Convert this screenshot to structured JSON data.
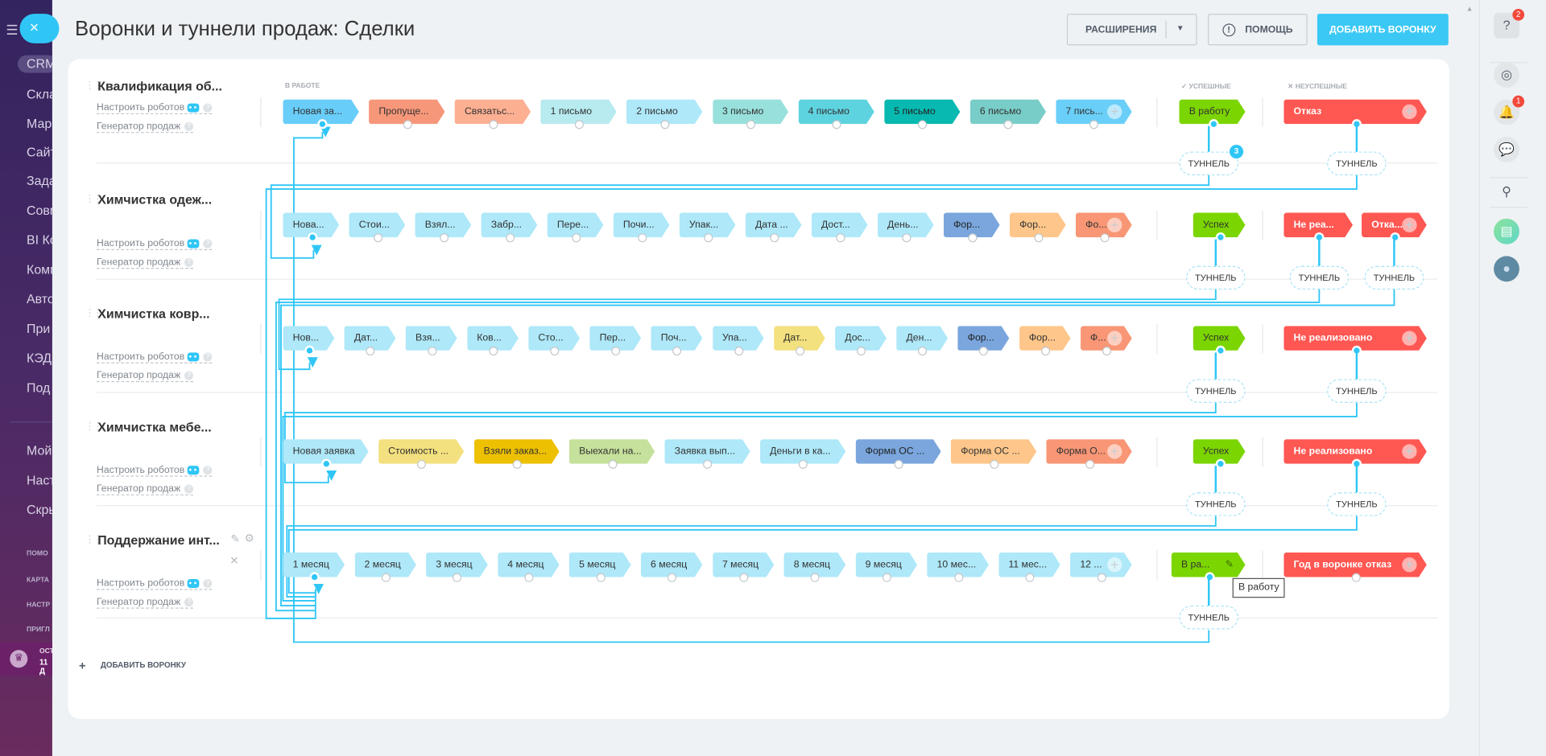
{
  "sidebar": {
    "close_label": "×",
    "menu_icon": "menu-icon",
    "items": [
      "CRM",
      "Скла",
      "Мар",
      "Сайт",
      "Зада",
      "Совм",
      "BI Ко",
      "Комм",
      "Авто",
      "При",
      "КЭД",
      "Под"
    ],
    "items2": [
      "Мой",
      "Наст",
      "Скры"
    ],
    "small": [
      "ПОМО",
      "КАРТА",
      "НАСТР",
      "ПРИГЛ"
    ],
    "promo": [
      "ОСТ",
      "11 Д"
    ]
  },
  "header": {
    "title": "Воронки и туннели продаж: Сделки",
    "extensions": "РАСШИРЕНИЯ",
    "help": "ПОМОЩЬ",
    "add_funnel": "ДОБАВИТЬ ВОРОНКУ"
  },
  "sections": {
    "in_work": "В РАБОТЕ",
    "success": "УСПЕШНЫЕ",
    "fail": "НЕУСПЕШНЫЕ"
  },
  "links": {
    "robots": "Настроить роботов",
    "generator": "Генератор продаж",
    "help_mark": "?"
  },
  "add_funnel_bottom": "ДОБАВИТЬ ВОРОНКУ",
  "tunnel_label": "ТУННЕЛЬ",
  "tooltip": "В работу",
  "funnels": [
    {
      "title": "Квалификация об...",
      "stages": [
        {
          "label": "Новая за...",
          "color": "#68cdf8"
        },
        {
          "label": "Пропуще...",
          "color": "#f7977a"
        },
        {
          "label": "Связатьс...",
          "color": "#fdaf92"
        },
        {
          "label": "1 письмо",
          "color": "#b7ebf0"
        },
        {
          "label": "2 письмо",
          "color": "#aee8f9"
        },
        {
          "label": "3 письмо",
          "color": "#98e0dc"
        },
        {
          "label": "4 письмо",
          "color": "#5ed3e0"
        },
        {
          "label": "5 письмо",
          "color": "#07b9b0"
        },
        {
          "label": "6 письмо",
          "color": "#79cdc8"
        },
        {
          "label": "7 пись...",
          "color": "#6acff8"
        }
      ],
      "success": {
        "label": "В работу",
        "color": "#7bd500"
      },
      "fail": [
        {
          "label": "Отказ",
          "color": "#ff5752"
        }
      ],
      "tunnels": [
        {
          "badge": "3"
        },
        {}
      ]
    },
    {
      "title": "Химчистка одеж...",
      "stages": [
        {
          "label": "Нова...",
          "color": "#aee8f9"
        },
        {
          "label": "Стои...",
          "color": "#aee8f9"
        },
        {
          "label": "Взял...",
          "color": "#aee8f9"
        },
        {
          "label": "Забр...",
          "color": "#aee8f9"
        },
        {
          "label": "Пере...",
          "color": "#aee8f9"
        },
        {
          "label": "Почи...",
          "color": "#aee8f9"
        },
        {
          "label": "Упак...",
          "color": "#aee8f9"
        },
        {
          "label": "Дата ...",
          "color": "#aee8f9"
        },
        {
          "label": "Дост...",
          "color": "#aee8f9"
        },
        {
          "label": "День...",
          "color": "#aee8f9"
        },
        {
          "label": "Фор...",
          "color": "#7aa6dd"
        },
        {
          "label": "Фор...",
          "color": "#fec68a"
        },
        {
          "label": "Фо...",
          "color": "#f89675"
        }
      ],
      "success": {
        "label": "Успех",
        "color": "#7bd500"
      },
      "fail": [
        {
          "label": "Не реа...",
          "color": "#ff5752"
        },
        {
          "label": "Отка...",
          "color": "#ff5752"
        }
      ],
      "tunnels": [
        {},
        {},
        {}
      ]
    },
    {
      "title": "Химчистка ковр...",
      "stages": [
        {
          "label": "Нов...",
          "color": "#aee8f9"
        },
        {
          "label": "Дат...",
          "color": "#aee8f9"
        },
        {
          "label": "Взя...",
          "color": "#aee8f9"
        },
        {
          "label": "Ков...",
          "color": "#aee8f9"
        },
        {
          "label": "Сто...",
          "color": "#aee8f9"
        },
        {
          "label": "Пер...",
          "color": "#aee8f9"
        },
        {
          "label": "Поч...",
          "color": "#aee8f9"
        },
        {
          "label": "Упа...",
          "color": "#aee8f9"
        },
        {
          "label": "Дат...",
          "color": "#f3e07e"
        },
        {
          "label": "Дос...",
          "color": "#aee8f9"
        },
        {
          "label": "Ден...",
          "color": "#aee8f9"
        },
        {
          "label": "Фор...",
          "color": "#7aa6dd"
        },
        {
          "label": "Фор...",
          "color": "#fec68a"
        },
        {
          "label": "Ф...",
          "color": "#f89675"
        }
      ],
      "success": {
        "label": "Успех",
        "color": "#7bd500"
      },
      "fail": [
        {
          "label": "Не реализовано",
          "color": "#ff5752"
        }
      ],
      "tunnels": [
        {},
        {}
      ]
    },
    {
      "title": "Химчистка мебе...",
      "stages": [
        {
          "label": "Новая заявка",
          "color": "#aee8f9"
        },
        {
          "label": "Стоимость ...",
          "color": "#f3e07e"
        },
        {
          "label": "Взяли заказ...",
          "color": "#edc001"
        },
        {
          "label": "Выехали на...",
          "color": "#c6e19b"
        },
        {
          "label": "Заявка вып...",
          "color": "#aee8f9"
        },
        {
          "label": "Деньги в ка...",
          "color": "#aee8f9"
        },
        {
          "label": "Форма ОС ...",
          "color": "#7aa6dd"
        },
        {
          "label": "Форма ОС ...",
          "color": "#fec68a"
        },
        {
          "label": "Форма О...",
          "color": "#f89675"
        }
      ],
      "success": {
        "label": "Успех",
        "color": "#7bd500"
      },
      "fail": [
        {
          "label": "Не реализовано",
          "color": "#ff5752"
        }
      ],
      "tunnels": [
        {},
        {}
      ]
    },
    {
      "title": "Поддержание инт...",
      "stages": [
        {
          "label": "1 месяц",
          "color": "#aee8f9"
        },
        {
          "label": "2 месяц",
          "color": "#aee8f9"
        },
        {
          "label": "3 месяц",
          "color": "#aee8f9"
        },
        {
          "label": "4 месяц",
          "color": "#aee8f9"
        },
        {
          "label": "5 месяц",
          "color": "#aee8f9"
        },
        {
          "label": "6 месяц",
          "color": "#aee8f9"
        },
        {
          "label": "7 месяц",
          "color": "#aee8f9"
        },
        {
          "label": "8 месяц",
          "color": "#aee8f9"
        },
        {
          "label": "9 месяц",
          "color": "#aee8f9"
        },
        {
          "label": "10 мес...",
          "color": "#aee8f9"
        },
        {
          "label": "11 мес...",
          "color": "#aee8f9"
        },
        {
          "label": "12 ...",
          "color": "#aee8f9"
        }
      ],
      "success": {
        "label": "В ра...",
        "color": "#7bd500"
      },
      "fail": [
        {
          "label": "Год в воронке отказ",
          "color": "#ff5752"
        }
      ],
      "tunnels": [
        {}
      ]
    }
  ],
  "right_panel": {
    "help_badge": "2",
    "bell_badge": "1"
  }
}
